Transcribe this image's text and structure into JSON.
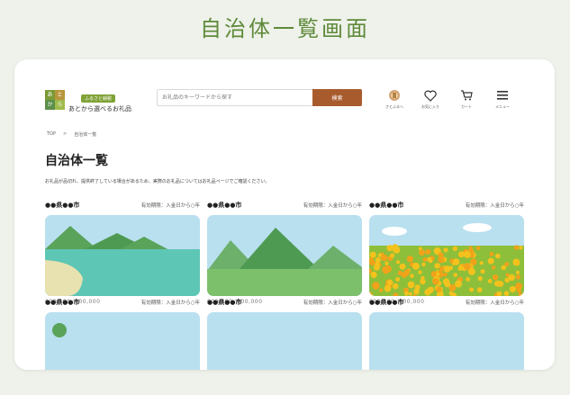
{
  "page_heading": "自治体一覧画面",
  "logo": {
    "mark": [
      "あ",
      "と",
      "か",
      "ら"
    ],
    "tag": "ふるさと納税",
    "name": "あとから選べるお礼品"
  },
  "search": {
    "placeholder": "お礼品のキーワードから探す",
    "button": "検索"
  },
  "nav": [
    {
      "label": "さとふるへ",
      "icon": "furusato-icon"
    },
    {
      "label": "お気に入り",
      "icon": "heart-icon"
    },
    {
      "label": "カート",
      "icon": "cart-icon"
    },
    {
      "label": "メニュー",
      "icon": "menu-icon"
    }
  ],
  "breadcrumb": {
    "home": "TOP",
    "separator": ">",
    "current": "自治体一覧"
  },
  "list_title": "自治体一覧",
  "notice": "お礼品が品切れ、提供終了している場合があるため、実際のお礼品についてはお礼品ページでご確認ください。",
  "cities": [
    {
      "name": "●●県●●市",
      "period": "有効期限：入金日から○年",
      "meta": "000,000, 000,000",
      "scene": "lake"
    },
    {
      "name": "●●県●●市",
      "period": "有効期限：入金日から○年",
      "meta": "000,000, 000,000",
      "scene": "hills"
    },
    {
      "name": "●●県●●市",
      "period": "有効期限：入金日から○年",
      "meta": "000,000, 000,000",
      "scene": "flowers"
    },
    {
      "name": "●●県●●市",
      "period": "有効期限：入金日から○年",
      "meta": "",
      "scene": "sky"
    },
    {
      "name": "●●県●●市",
      "period": "有効期限：入金日から○年",
      "meta": "",
      "scene": "sky"
    },
    {
      "name": "●●県●●市",
      "period": "有効期限：入金日から○年",
      "meta": "",
      "scene": "sky"
    }
  ],
  "colors": {
    "accent": "#5f8a3a",
    "search_button": "#a85c2d",
    "sky": "#b9e0ef",
    "mountain": "#5aa35a"
  }
}
